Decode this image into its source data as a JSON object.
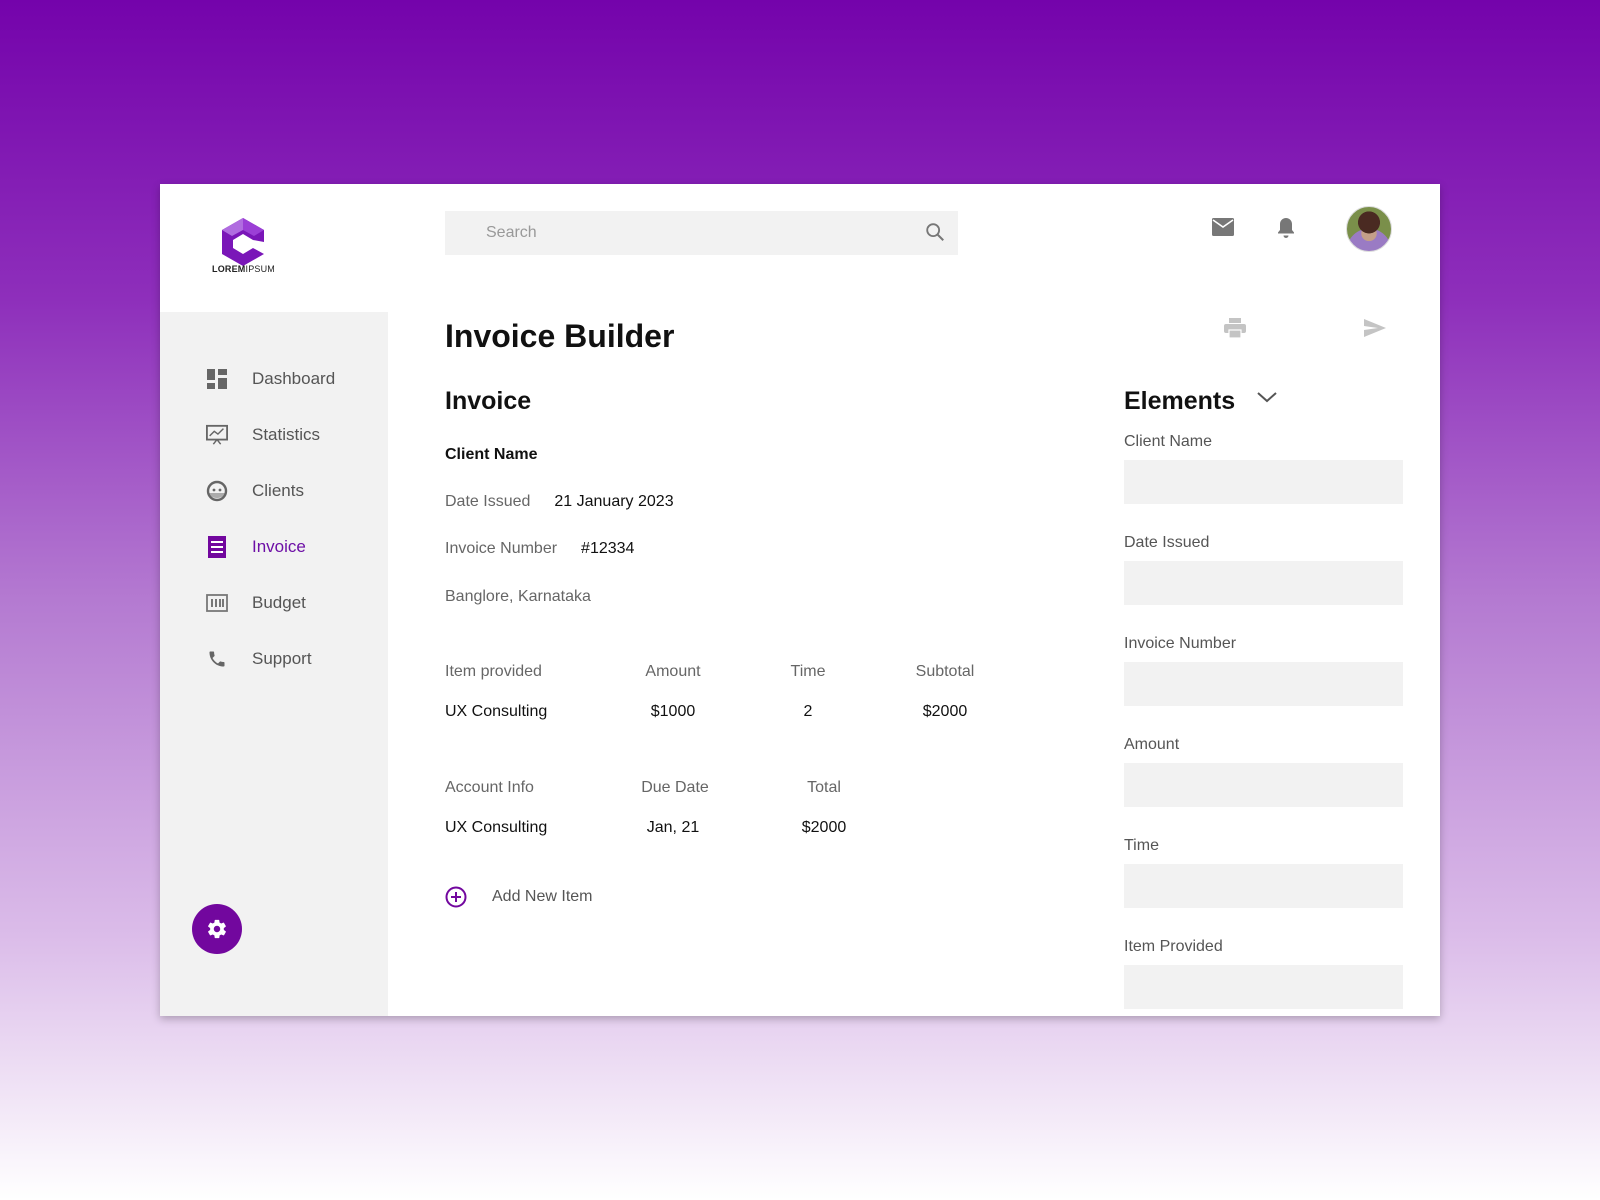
{
  "brand": {
    "logo_text_bold": "LOREM",
    "logo_text_light": "IPSUM",
    "accent_color": "#72079e"
  },
  "search": {
    "placeholder": "Search"
  },
  "sidebar": {
    "items": [
      {
        "label": "Dashboard",
        "icon": "dashboard-icon"
      },
      {
        "label": "Statistics",
        "icon": "statistics-icon"
      },
      {
        "label": "Clients",
        "icon": "clients-icon"
      },
      {
        "label": "Invoice",
        "icon": "invoice-icon",
        "active": true
      },
      {
        "label": "Budget",
        "icon": "budget-icon"
      },
      {
        "label": "Support",
        "icon": "phone-icon"
      }
    ]
  },
  "header": {
    "icons": [
      "mail-icon",
      "bell-icon",
      "avatar"
    ]
  },
  "main": {
    "title": "Invoice Builder",
    "section_title": "Invoice",
    "client_name": "Client Name",
    "date_issued": {
      "label": "Date Issued",
      "value": "21 January 2023"
    },
    "invoice_number": {
      "label": "Invoice Number",
      "value": "#12334"
    },
    "address": "Banglore, Karnataka",
    "items_table": {
      "headers": [
        "Item provided",
        "Amount",
        "Time",
        "Subtotal"
      ],
      "rows": [
        [
          "UX Consulting",
          "$1000",
          "2",
          "$2000"
        ]
      ]
    },
    "account_table": {
      "headers": [
        "Account Info",
        "Due Date",
        "Total"
      ],
      "rows": [
        [
          "UX Consulting",
          "Jan, 21",
          "$2000"
        ]
      ]
    },
    "add_item_label": "Add New Item"
  },
  "elements": {
    "title": "Elements",
    "fields": [
      {
        "label": "Client Name",
        "value": ""
      },
      {
        "label": "Date Issued",
        "value": ""
      },
      {
        "label": "Invoice Number",
        "value": ""
      },
      {
        "label": "Amount",
        "value": ""
      },
      {
        "label": "Time",
        "value": ""
      },
      {
        "label": "Item Provided",
        "value": ""
      }
    ]
  }
}
